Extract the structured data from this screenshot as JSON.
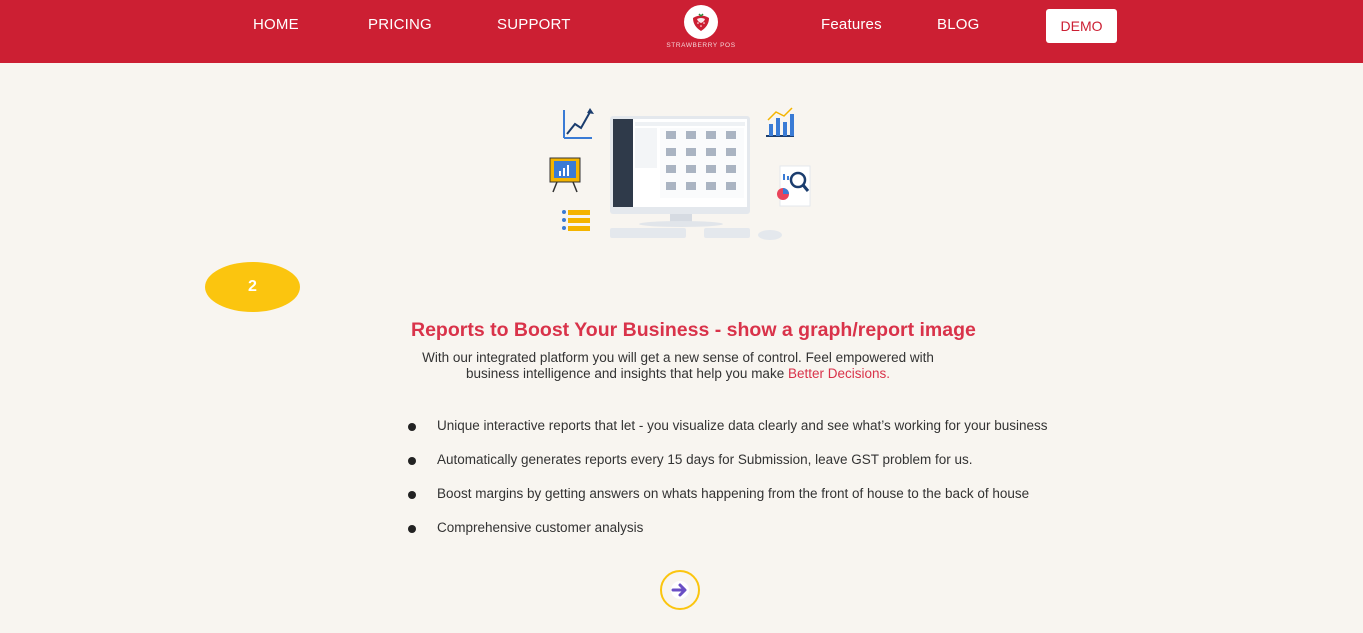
{
  "nav": {
    "items": [
      {
        "label": "HOME"
      },
      {
        "label": "PRICING"
      },
      {
        "label": "SUPPORT"
      },
      {
        "label": "Features"
      },
      {
        "label": "BLOG"
      }
    ],
    "logo_text": "STRAWBERRY POS",
    "demo_label": "DEMO",
    "brand_color": "#cc1f33"
  },
  "step": {
    "number": "2",
    "color": "#fbc50f"
  },
  "section": {
    "headline": "Reports to Boost Your Business - show a graph/report image",
    "description_line1": "With our integrated platform you will get a new sense of control. Feel empowered with",
    "description_line2": "business intelligence and insights that help you make ",
    "description_accent": "Better Decisions.",
    "features": [
      "Unique interactive reports that let - you visualize data clearly and see what’s working for your business",
      "Automatically generates reports every 15 days for Submission, leave GST problem for us.",
      "Boost margins by getting answers on whats happening from the front of house to the back of house",
      "Comprehensive customer analysis"
    ]
  },
  "icons": {
    "logo": "strawberry-icon",
    "next": "arrow-right-icon",
    "hero": "dashboard-monitor-illustration"
  }
}
